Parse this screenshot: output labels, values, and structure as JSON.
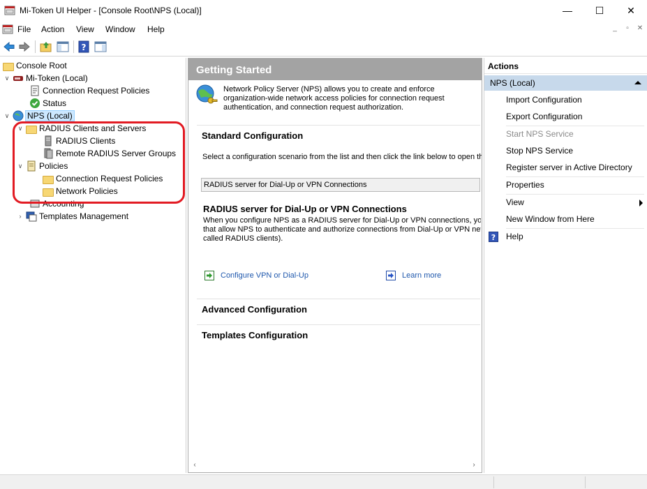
{
  "window": {
    "title": "Mi-Token UI Helper - [Console Root\\NPS (Local)]",
    "controls": {
      "minimize": "—",
      "maximize": "☐",
      "close": "✕"
    }
  },
  "menu": {
    "items": [
      "File",
      "Action",
      "View",
      "Window",
      "Help"
    ],
    "mdi_controls": {
      "minimize": "_",
      "restore": "▫",
      "close": "✕"
    }
  },
  "toolbar": {
    "buttons": [
      "back-arrow-icon",
      "forward-arrow-icon",
      "up-folder-icon",
      "show-hide-tree-icon",
      "help-icon",
      "show-hide-action-pane-icon"
    ]
  },
  "tree": {
    "console_root": "Console Root",
    "mitoken": "Mi-Token (Local)",
    "mitoken_crp": "Connection Request Policies",
    "mitoken_status": "Status",
    "nps": "NPS (Local)",
    "radius_clients_servers": "RADIUS Clients and Servers",
    "radius_clients": "RADIUS Clients",
    "remote_groups": "Remote RADIUS Server Groups",
    "policies": "Policies",
    "crp": "Connection Request Policies",
    "network_policies": "Network Policies",
    "accounting": "Accounting",
    "templates": "Templates Management"
  },
  "center": {
    "header": "Getting Started",
    "intro": "Network Policy Server (NPS) allows you to create and enforce organization-wide network access policies for connection request authentication, and connection request authorization.",
    "standard_config": "Standard Configuration",
    "standard_desc": "Select a configuration scenario from the list and then click the link below to open the",
    "scenario_select": "RADIUS server for Dial-Up or VPN Connections",
    "scenario_title": "RADIUS server for Dial-Up or VPN Connections",
    "scenario_desc_1": "When you configure NPS as a RADIUS server for Dial-Up or VPN connections, you",
    "scenario_desc_2": "that allow NPS to authenticate and authorize connections from Dial-Up or VPN netw",
    "scenario_desc_3": "called RADIUS clients).",
    "configure_link": "Configure VPN or Dial-Up",
    "learn_more": "Learn more",
    "advanced_config": "Advanced Configuration",
    "templates_config": "Templates Configuration"
  },
  "actions": {
    "header": "Actions",
    "group": "NPS (Local)",
    "items": {
      "import": "Import Configuration",
      "export": "Export Configuration",
      "start": "Start NPS Service",
      "stop": "Stop NPS Service",
      "register": "Register server in Active Directory",
      "properties": "Properties",
      "view": "View",
      "new_window": "New Window from Here",
      "help": "Help"
    }
  },
  "colors": {
    "header_gray": "#a3a3a3",
    "action_group": "#c7d9eb",
    "link": "#1f58ad",
    "highlight_box": "#e21b23",
    "selection": "#cce8ff"
  }
}
